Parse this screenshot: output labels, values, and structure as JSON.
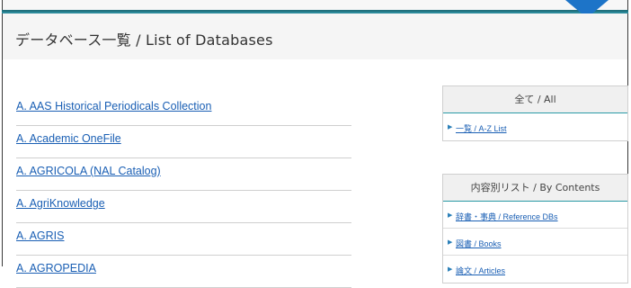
{
  "page": {
    "title": "データベース一覧 / List of Databases"
  },
  "databases": [
    "A. AAS Historical Periodicals Collection",
    "A. Academic OneFile",
    "A. AGRICOLA (NAL Catalog)",
    "A. AgriKnowledge",
    "A. AGRIS",
    "A. AGROPEDIA"
  ],
  "panels": {
    "all": {
      "heading": "全て / All",
      "items": [
        "一覧 / A-Z List"
      ]
    },
    "contents": {
      "heading": "内容別リスト / By Contents",
      "items": [
        "辞書・事典 / Reference DBs",
        "図書 / Books",
        "論文 / Articles"
      ]
    }
  },
  "colors": {
    "accent_teal": "#2a9aa6",
    "link_blue": "#1a5fb4",
    "arrow_blue": "#1d74c8"
  }
}
